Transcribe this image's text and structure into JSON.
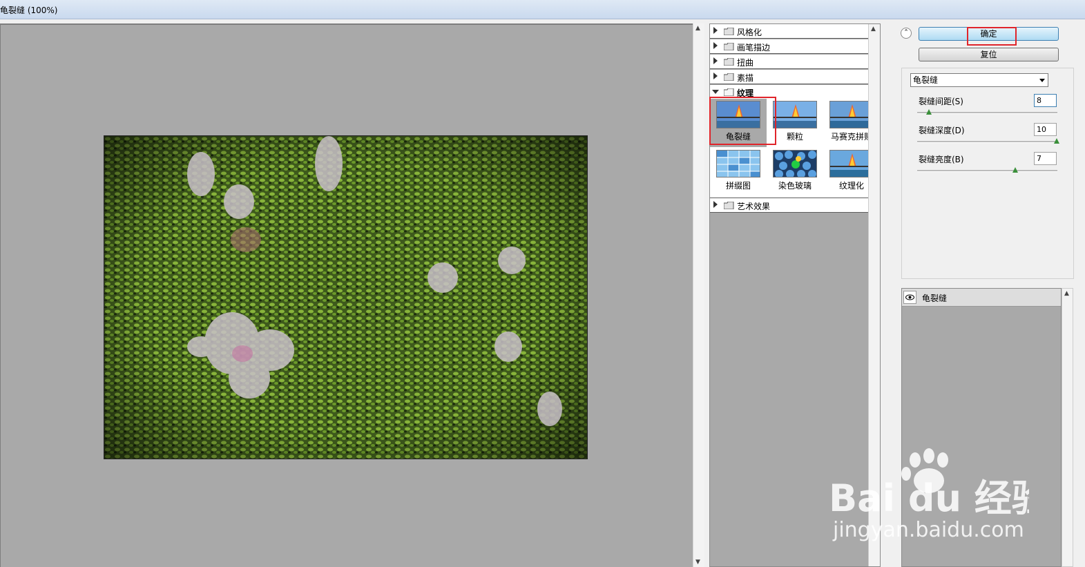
{
  "window": {
    "title": "龟裂缝 (100%)"
  },
  "gallery": {
    "categories": [
      {
        "label": "风格化",
        "expanded": false
      },
      {
        "label": "画笔描边",
        "expanded": false
      },
      {
        "label": "扭曲",
        "expanded": false
      },
      {
        "label": "素描",
        "expanded": false
      },
      {
        "label": "纹理",
        "expanded": true
      },
      {
        "label": "艺术效果",
        "expanded": false
      }
    ],
    "texture_filters": [
      {
        "label": "龟裂缝",
        "selected": true
      },
      {
        "label": "颗粒"
      },
      {
        "label": "马赛克拼贴"
      },
      {
        "label": "拼缀图"
      },
      {
        "label": "染色玻璃"
      },
      {
        "label": "纹理化"
      }
    ]
  },
  "buttons": {
    "ok": "确定",
    "reset": "复位"
  },
  "settings": {
    "filter_select": "龟裂缝",
    "params": [
      {
        "label": "裂缝间距(S)",
        "value": "8",
        "fraction": 0.08
      },
      {
        "label": "裂缝深度(D)",
        "value": "10",
        "fraction": 1.0
      },
      {
        "label": "裂缝亮度(B)",
        "value": "7",
        "fraction": 0.7
      }
    ]
  },
  "layers": {
    "items": [
      {
        "label": "龟裂缝",
        "visible": true
      }
    ]
  },
  "watermark": {
    "brand": "Bai du 经验",
    "url": "jingyan.baidu.com"
  },
  "colors": {
    "accent": "#3c7fb1",
    "highlight": "#e0242a",
    "slider": "#3a8f3a"
  }
}
